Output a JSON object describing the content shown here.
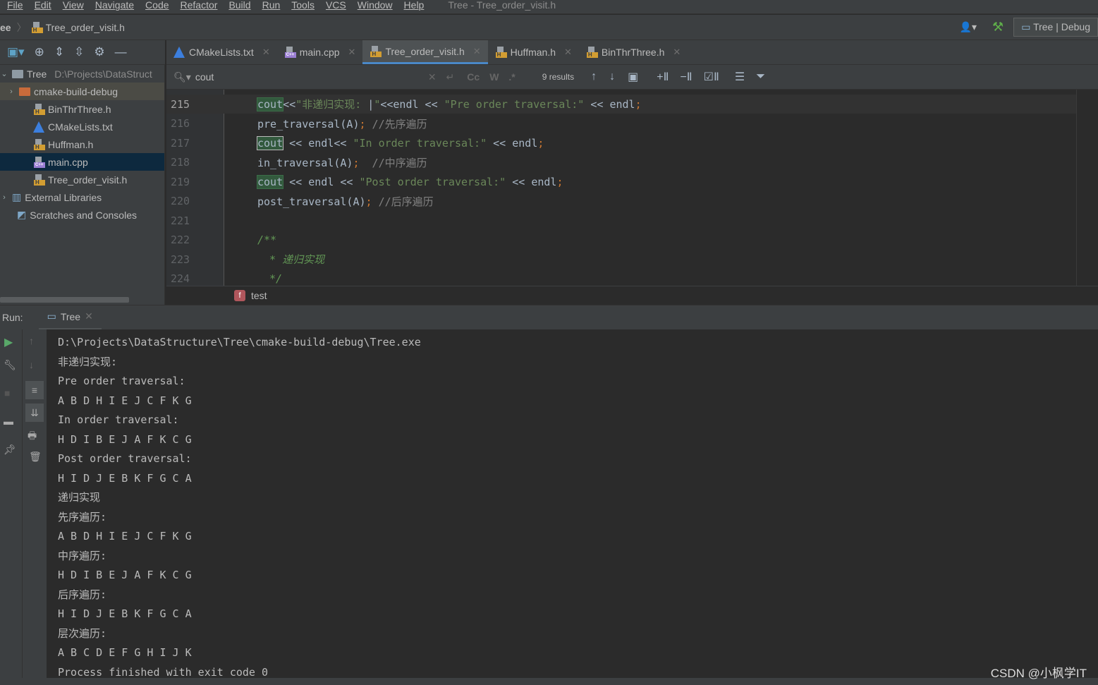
{
  "menu": [
    "File",
    "Edit",
    "View",
    "Navigate",
    "Code",
    "Refactor",
    "Build",
    "Run",
    "Tools",
    "VCS",
    "Window",
    "Help"
  ],
  "window_title": "Tree - Tree_order_visit.h",
  "navbar": {
    "project": "ee",
    "file": "Tree_order_visit.h",
    "run_config": "Tree | Debug"
  },
  "tabs": [
    {
      "label": "CMakeLists.txt",
      "icon": "cmake-icon"
    },
    {
      "label": "main.cpp",
      "icon": "cpp-file-icon"
    },
    {
      "label": "Tree_order_visit.h",
      "icon": "header-file-icon",
      "active": true
    },
    {
      "label": "Huffman.h",
      "icon": "header-file-icon"
    },
    {
      "label": "BinThrThree.h",
      "icon": "header-file-icon"
    }
  ],
  "project_tree": {
    "root": "Tree",
    "root_path": "D:\\Projects\\DataStruct",
    "items": [
      "cmake-build-debug",
      "BinThrThree.h",
      "CMakeLists.txt",
      "Huffman.h",
      "main.cpp",
      "Tree_order_visit.h"
    ],
    "external": "External Libraries",
    "scratches": "Scratches and Consoles",
    "selected": "main.cpp"
  },
  "find": {
    "query": "cout",
    "results": "9 results",
    "cc": "Cc",
    "w": "W",
    "regex": ".*"
  },
  "editor": {
    "line_numbers": [
      "215",
      "216",
      "217",
      "218",
      "219",
      "220",
      "221",
      "222",
      "223",
      "224"
    ],
    "lines": [
      [
        [
          "m",
          "cout"
        ],
        [
          "k",
          "<<"
        ],
        [
          "s",
          "\"非递归实现: "
        ],
        [
          "k",
          "|"
        ],
        [
          "s",
          "\""
        ],
        [
          "k",
          "<<endl << "
        ],
        [
          "s",
          "\"Pre order traversal:\""
        ],
        [
          "k",
          " << endl"
        ],
        [
          "p",
          ";"
        ]
      ],
      [
        [
          "k",
          "pre_traversal(A)"
        ],
        [
          "p",
          ";"
        ],
        [
          "c",
          " //先序遍历"
        ]
      ],
      [
        [
          "m2",
          "cout"
        ],
        [
          "k",
          " << endl<< "
        ],
        [
          "s",
          "\"In order traversal:\""
        ],
        [
          "k",
          " << endl"
        ],
        [
          "p",
          ";"
        ]
      ],
      [
        [
          "k",
          "in_traversal(A)"
        ],
        [
          "p",
          ";"
        ],
        [
          "c",
          "  //中序遍历"
        ]
      ],
      [
        [
          "m",
          "cout"
        ],
        [
          "k",
          " << endl << "
        ],
        [
          "s",
          "\"Post order traversal:\""
        ],
        [
          "k",
          " << endl"
        ],
        [
          "p",
          ";"
        ]
      ],
      [
        [
          "k",
          "post_traversal(A)"
        ],
        [
          "p",
          ";"
        ],
        [
          "c",
          " //后序遍历"
        ]
      ],
      [],
      [
        [
          "dc",
          "/**"
        ]
      ],
      [
        [
          "dc",
          " * 递归实现"
        ]
      ],
      [
        [
          "dc",
          " */"
        ]
      ]
    ]
  },
  "breadcrumb": {
    "function": "test",
    "badge": "f"
  },
  "run": {
    "label": "Run:",
    "tab": "Tree"
  },
  "console": [
    "D:\\Projects\\DataStructure\\Tree\\cmake-build-debug\\Tree.exe",
    "非递归实现:",
    "Pre order traversal:",
    "A B D H I E J C F K G",
    "In order traversal:",
    "H D I B E J A F K C G",
    "Post order traversal:",
    "H I D J E B K F G C A",
    "递归实现",
    "先序遍历:",
    "A B D H I E J C F K G",
    "中序遍历:",
    "H D I B E J A F K C G",
    "后序遍历:",
    "H I D J E B K F G C A",
    "层次遍历:",
    "A B C D E F G H I J K",
    "Process finished with exit code 0"
  ],
  "watermark": "CSDN @小枫学IT"
}
